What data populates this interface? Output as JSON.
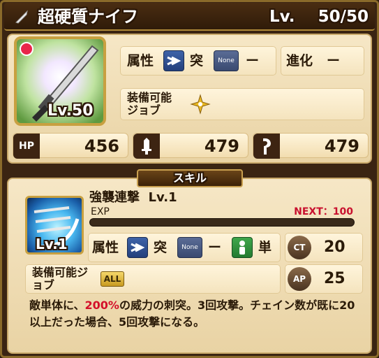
{
  "weapon": {
    "name": "超硬質ナイフ",
    "level_label": "Lv.",
    "level_current": "50/",
    "level_max": "50",
    "portrait_level": "Lv.50"
  },
  "attributes": {
    "label": "属性",
    "type1_icon": "thrust-icon",
    "type1_text": "突",
    "type2_icon": "none-icon",
    "type2_badge": "None",
    "type2_text": "ー",
    "evolution_label": "進化",
    "evolution_value": "ー",
    "equip_label": "装備可能ジョブ",
    "equip_job_icon": "shuriken-icon"
  },
  "stats": [
    {
      "icon": "hp-icon",
      "label": "HP",
      "value": "456"
    },
    {
      "icon": "sword-icon",
      "label": "",
      "value": "479"
    },
    {
      "icon": "magic-icon",
      "label": "",
      "value": "479"
    }
  ],
  "skill": {
    "section_title": "スキル",
    "name": "強襲連撃",
    "level": "Lv.1",
    "icon_level": "Lv.1",
    "exp_label": "EXP",
    "next_label": "NEXT：100",
    "exp_progress": 0,
    "attr_label": "属性",
    "type1_text": "突",
    "type2_badge": "None",
    "type2_text": "ー",
    "target_text": "単",
    "ct_label": "CT",
    "ct_value": "20",
    "ap_label": "AP",
    "ap_value": "25",
    "equip_label": "装備可能ジョブ",
    "equip_badge": "ALL",
    "desc_pre": "敵単体に、",
    "desc_highlight": "200%",
    "desc_post": "の威力の刺突。3回攻撃。チェイン数が既に20以上だった場合、5回攻撃になる。"
  },
  "colors": {
    "accent_gold": "#c8a040",
    "highlight_red": "#d4102a",
    "thrust_blue": "#3e63a8",
    "single_green": "#3fa74c"
  }
}
